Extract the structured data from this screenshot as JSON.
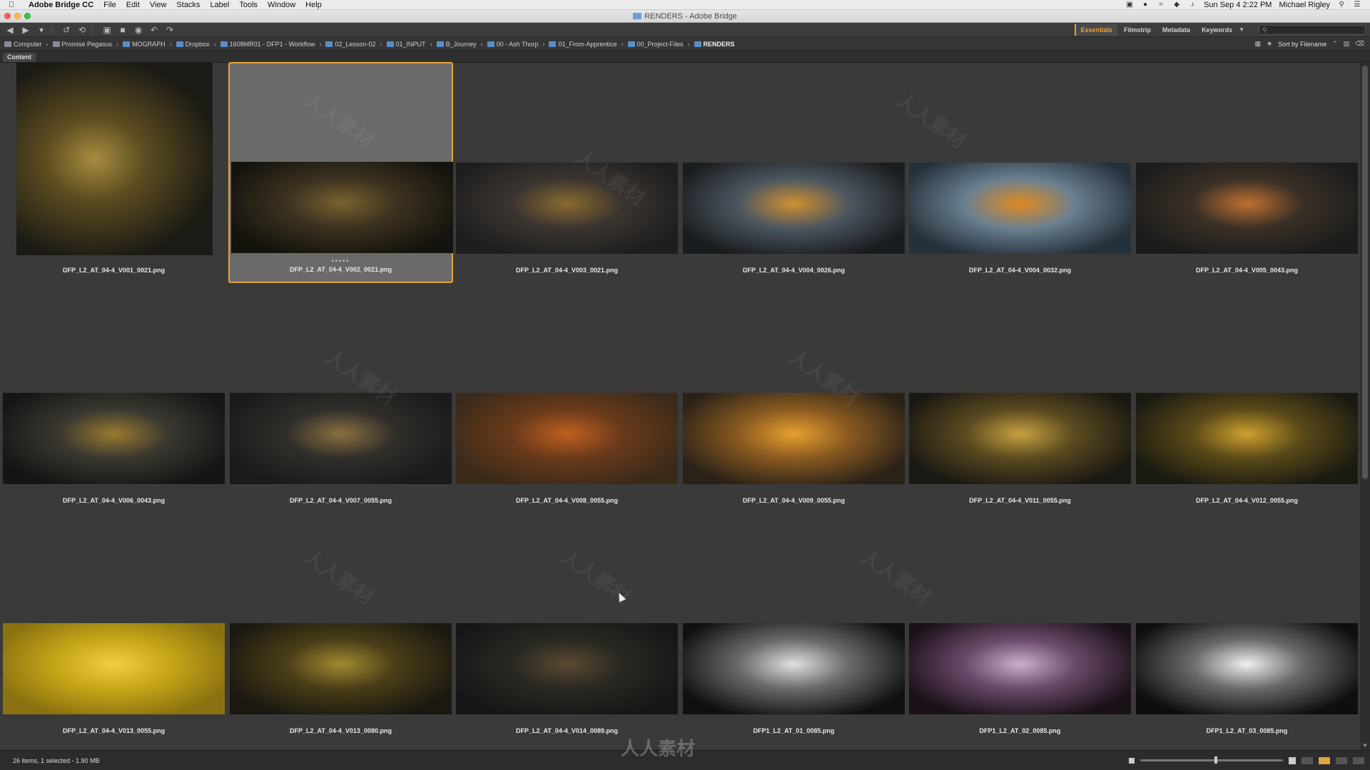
{
  "menubar": {
    "app_name": "Adobe Bridge CC",
    "items": [
      "File",
      "Edit",
      "View",
      "Stacks",
      "Label",
      "Tools",
      "Window",
      "Help"
    ],
    "clock": "Sun Sep 4  2:22 PM",
    "user": "Michael Rigley"
  },
  "window": {
    "title": "RENDERS - Adobe Bridge"
  },
  "toolbar": {
    "workspaces": [
      "Essentials",
      "Filmstrip",
      "Metadata",
      "Keywords"
    ],
    "active_workspace": "Essentials",
    "search_placeholder": ""
  },
  "pathbar": {
    "crumbs": [
      "Computer",
      "Promise Pegasus",
      "MOGRAPH",
      "Dropbox",
      "1608MR01 - DFP1 - Workflow",
      "02_Lesson-02",
      "01_INPUT",
      "B_Journey",
      "00 - Ash Thorp",
      "01_From-Apprentice",
      "00_Project-Files",
      "RENDERS"
    ],
    "sort_label": "Sort by Filename"
  },
  "panel": {
    "tab_label": "Content"
  },
  "thumbnails": [
    {
      "label": "DFP_L2_AT_04-4_V001_0021.png",
      "colors": [
        "#1b1a14",
        "#5c4c20",
        "#a88d3f"
      ],
      "orientation": "portrait"
    },
    {
      "label": "DFP_L2_AT_04-4_V002_0021.png",
      "colors": [
        "#15130d",
        "#3c3220",
        "#7a6230"
      ],
      "orientation": "landscape",
      "selected": true
    },
    {
      "label": "DFP_L2_AT_04-4_V003_0021.png",
      "colors": [
        "#1e1e1e",
        "#3b3530",
        "#8a6a30"
      ]
    },
    {
      "label": "DFP_L2_AT_04-4_V004_0026.png",
      "colors": [
        "#1a1d20",
        "#4d5760",
        "#d09030"
      ]
    },
    {
      "label": "DFP_L2_AT_04-4_V004_0032.png",
      "colors": [
        "#24303a",
        "#6b8090",
        "#e08a20"
      ]
    },
    {
      "label": "DFP_L2_AT_04-4_V005_0043.png",
      "colors": [
        "#1c1c1c",
        "#3a3026",
        "#c07030"
      ]
    },
    {
      "label": "DFP_L2_AT_04-4_V006_0043.png",
      "colors": [
        "#151515",
        "#3a3830",
        "#9a7a30"
      ]
    },
    {
      "label": "DFP_L2_AT_04-4_V007_0055.png",
      "colors": [
        "#1a1a1a",
        "#302e2a",
        "#8a7040"
      ]
    },
    {
      "label": "DFP_L2_AT_04-4_V008_0055.png",
      "colors": [
        "#3a2a1a",
        "#6a3a1a",
        "#c06020"
      ]
    },
    {
      "label": "DFP_L2_AT_04-4_V009_0055.png",
      "colors": [
        "#2a2218",
        "#8a5a20",
        "#e8a030"
      ]
    },
    {
      "label": "DFP_L2_AT_04-4_V011_0055.png",
      "colors": [
        "#1a1812",
        "#5a4a20",
        "#c8a040"
      ]
    },
    {
      "label": "DFP_L2_AT_04-4_V012_0055.png",
      "colors": [
        "#1a1a12",
        "#5a4a18",
        "#d0a030"
      ]
    },
    {
      "label": "DFP_L2_AT_04-4_V013_0055.png",
      "colors": [
        "#8a7010",
        "#c8a818",
        "#f0d040"
      ]
    },
    {
      "label": "DFP_L2_AT_04-4_V013_0080.png",
      "colors": [
        "#1a1810",
        "#4a3e18",
        "#a08a30"
      ]
    },
    {
      "label": "DFP_L2_AT_04-4_V014_0089.png",
      "colors": [
        "#161616",
        "#2a2822",
        "#5a4a30"
      ]
    },
    {
      "label": "DFP1_L2_AT_01_0085.png",
      "colors": [
        "#101010",
        "#6a6a6a",
        "#e0e0e0"
      ]
    },
    {
      "label": "DFP1_L2_AT_02_0085.png",
      "colors": [
        "#1a1018",
        "#6a4a6a",
        "#c8b0c8"
      ]
    },
    {
      "label": "DFP1_L2_AT_03_0085.png",
      "colors": [
        "#0e0e0e",
        "#6a6a6a",
        "#f0f0f0"
      ]
    }
  ],
  "statusbar": {
    "text": "26 items, 1 selected - 1.90 MB",
    "zoom_fraction": 0.53
  },
  "watermark": {
    "text": "人人素材"
  },
  "colors": {
    "accent": "#e3a43a",
    "content_bg": "#3a3a3a"
  }
}
